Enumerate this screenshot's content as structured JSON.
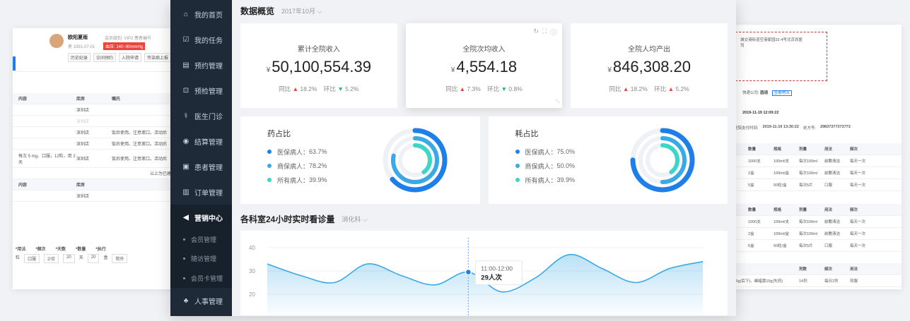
{
  "bg_left": {
    "patient_name": "欧阳夏雨",
    "patient_meta": "会员级别: VIP2  患者编号",
    "bp_text": "血压: 140~90mmHg",
    "birth": "男 1991-07-01",
    "tags": [
      "历史纪录",
      "诊间预约",
      "入院申请",
      "传染病上报"
    ],
    "table1_head": [
      "内容",
      "库房",
      "嘱托"
    ],
    "table1_rows": [
      [
        "",
        "深圳店",
        ""
      ],
      [
        "",
        "深圳店",
        ""
      ],
      [
        "",
        "深圳店",
        "饭后使用。注意漱口。活动后"
      ],
      [
        "",
        "深圳店",
        "饭后使用。注意漱口。活动后"
      ],
      [
        "每次 5 mg、口服，12粒，用 2 天",
        "深圳店",
        "饭后使用。注意漱口。活动后"
      ]
    ],
    "note": "以上为已建交易",
    "table2_head": [
      "内容",
      "库房"
    ],
    "table2_rows": [
      [
        "",
        "深圳店"
      ]
    ],
    "form_labels": [
      "*用法",
      "*频次",
      "*天数",
      "*数量",
      "*执行"
    ],
    "form_values": [
      "粒",
      "口服",
      "2/日",
      "20",
      "天",
      "20",
      "盒",
      "院外"
    ]
  },
  "bg_right": {
    "address": "城交港街道空港家园32-4号北京尚医",
    "address2": "司",
    "ship_label": "快递公司:",
    "ship_company": "圆通",
    "ship_btn": "查看物流",
    "date1": "2019-11-19 12:09:22",
    "pay_label": "医院支付时间:",
    "pay_time": "2019-11-19 13:30:22",
    "order_label": "处方号:",
    "order_no": "29837377373773",
    "table_head": [
      "数量",
      "规格",
      "剂量",
      "用法",
      "频次"
    ],
    "table_rows": [
      [
        "1000支",
        "100ml/支",
        "每次100ml",
        "前瞻清洁",
        "每天一次"
      ],
      [
        "2盒",
        "100ml/盒",
        "每次100ml",
        "前瞻清洁",
        "每天一次"
      ],
      [
        "5盒",
        "50粒/盒",
        "每次5片",
        "口服",
        "每天一次"
      ]
    ],
    "table2_rows": [
      [
        "1000支",
        "100ml/支",
        "每次100ml",
        "前瞻清洁",
        "每天一次"
      ],
      [
        "2盒",
        "100ml/盒",
        "每次100ml",
        "前瞻清洁",
        "每天一次"
      ],
      [
        "5盒",
        "50粒/盒",
        "每次5片",
        "口服",
        "每天一次"
      ]
    ],
    "table3_head": [
      "剂数",
      "频次",
      "用法"
    ],
    "table3_row": [
      "香Rg(后下)、蜂蜡黄10g(先煎)",
      "14剂",
      "每日2剂",
      "煎服"
    ]
  },
  "sidebar": {
    "items": [
      {
        "label": "我的首页",
        "icon": "home-icon",
        "glyph": "⌂"
      },
      {
        "label": "我的任务",
        "icon": "task-icon",
        "glyph": "☑"
      },
      {
        "label": "预约管理",
        "icon": "calendar-icon",
        "glyph": "▤"
      },
      {
        "label": "预检管理",
        "icon": "precheck-icon",
        "glyph": "⊡"
      },
      {
        "label": "医生门诊",
        "icon": "stethoscope-icon",
        "glyph": "⚕"
      },
      {
        "label": "结算管理",
        "icon": "settlement-icon",
        "glyph": "◉"
      },
      {
        "label": "患者管理",
        "icon": "patient-icon",
        "glyph": "▣"
      },
      {
        "label": "订单管理",
        "icon": "order-icon",
        "glyph": "▥"
      },
      {
        "label": "营销中心",
        "icon": "megaphone-icon",
        "glyph": "◀"
      }
    ],
    "sub_items": [
      "会员管理",
      "随访管理",
      "会员卡管理"
    ],
    "last_item": {
      "label": "人事管理",
      "icon": "org-icon",
      "glyph": "♣"
    }
  },
  "header": {
    "title": "数据概览",
    "date": "2017年10月 ⌵"
  },
  "stats": [
    {
      "label": "累计全院收入",
      "currency": "¥",
      "value": "50,100,554.39",
      "yoy_label": "同比",
      "yoy_arrow": "▲",
      "yoy": "18.2%",
      "mom_label": "环比",
      "mom_arrow": "▼",
      "mom": "5.2%"
    },
    {
      "label": "全院次均收入",
      "currency": "¥",
      "value": "4,554.18",
      "yoy_label": "同比",
      "yoy_arrow": "▲",
      "yoy": "7.3%",
      "mom_label": "环比",
      "mom_arrow": "▼",
      "mom": "0.8%"
    },
    {
      "label": "全院人均产出",
      "currency": "¥",
      "value": "846,308.20",
      "yoy_label": "同比",
      "yoy_arrow": "▲",
      "yoy": "18.2%",
      "mom_label": "环比",
      "mom_arrow": "▲",
      "mom": "5.2%"
    }
  ],
  "ratios": [
    {
      "title": "药占比",
      "items": [
        {
          "label": "医保病人：",
          "value": "63.7%",
          "color": "#1f7fe8"
        },
        {
          "label": "商保病人：",
          "value": "78.2%",
          "color": "#3aa9e6"
        },
        {
          "label": "所有病人：",
          "value": "39.9%",
          "color": "#3bd6c6"
        }
      ]
    },
    {
      "title": "耗占比",
      "items": [
        {
          "label": "医保病人：",
          "value": "75.0%",
          "color": "#1f7fe8"
        },
        {
          "label": "商保病人：",
          "value": "50.0%",
          "color": "#3aa9e6"
        },
        {
          "label": "所有病人：",
          "value": "39.9%",
          "color": "#3bd6c6"
        }
      ]
    }
  ],
  "section": {
    "title": "各科室24小时实时看诊量",
    "dept": "消化科 ⌵"
  },
  "chart_data": {
    "type": "area",
    "y_ticks": [
      "40",
      "30",
      "20"
    ],
    "ylim": [
      15,
      45
    ],
    "x": [
      0,
      1,
      2,
      3,
      4,
      5,
      6,
      7,
      8,
      9,
      10,
      11,
      12,
      13
    ],
    "values": [
      33,
      28,
      25,
      33,
      28,
      24,
      29.5,
      21,
      27,
      37,
      31,
      25,
      31,
      34
    ],
    "highlight_index": 6,
    "tooltip_time": "11:00-12:00",
    "tooltip_value": "29人次",
    "line_color": "#3aa9e6"
  }
}
